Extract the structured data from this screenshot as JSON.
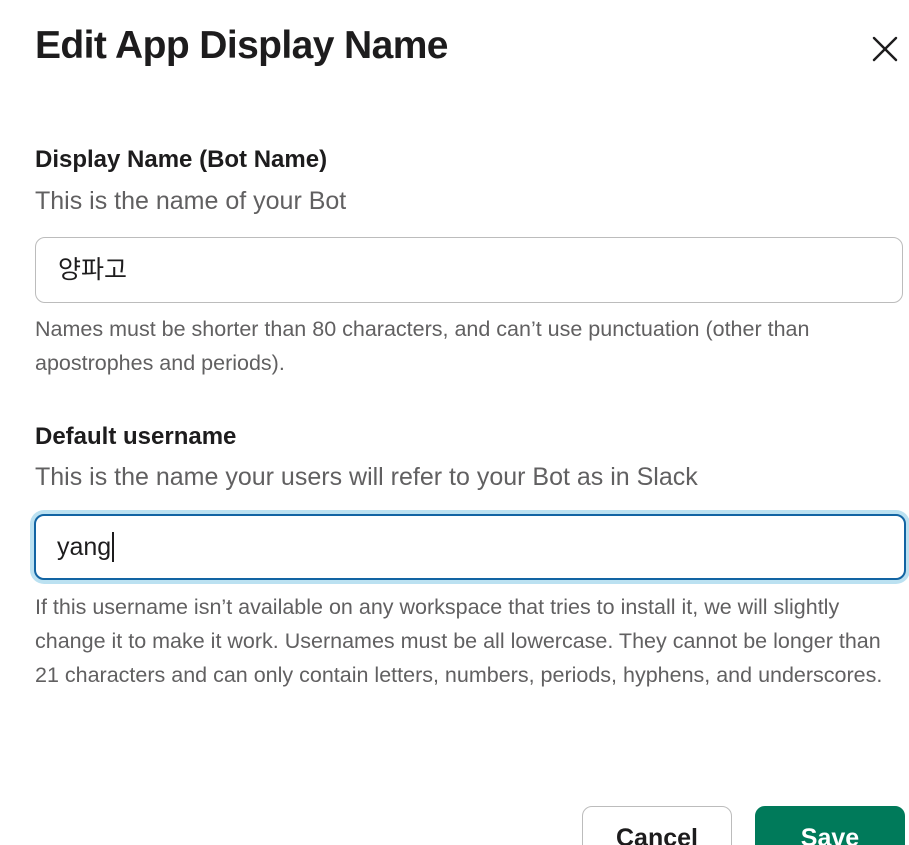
{
  "dialog": {
    "title": "Edit App Display Name"
  },
  "display_name_field": {
    "label": "Display Name (Bot Name)",
    "description": "This is the name of your Bot",
    "value": "양파고",
    "help": "Names must be shorter than 80 characters, and can’t use punctuation (other than apostrophes and periods)."
  },
  "username_field": {
    "label": "Default username",
    "description": "This is the name your users will refer to your Bot as in Slack",
    "value": "yang",
    "help": "If this username isn’t available on any workspace that tries to install it, we will slightly change it to make it work. Usernames must be all lowercase. They cannot be longer than 21 characters and can only contain letters, numbers, periods, hyphens, and underscores."
  },
  "actions": {
    "cancel_label": "Cancel",
    "save_label": "Save"
  },
  "icons": {
    "close": "close-icon"
  },
  "colors": {
    "primary_button": "#007a5a",
    "focus_ring": "#1264a3",
    "text": "#1d1c1d",
    "muted_text": "#616061"
  }
}
